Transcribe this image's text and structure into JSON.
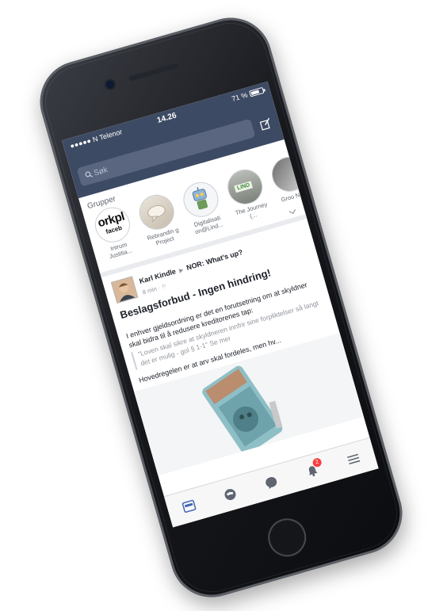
{
  "status": {
    "carrier": "●●●●● N Telenor",
    "time": "14.26",
    "battery": "71 %",
    "battery_level": 0.71
  },
  "search": {
    "placeholder": "Søk"
  },
  "groups": {
    "title": "Grupper",
    "items": [
      {
        "name": "Intrum Justitia...",
        "logo_text": "orkpl",
        "logo_sub": "faceb",
        "icon": "workplace-logo"
      },
      {
        "name": "Rebrandin g Project",
        "icon": "rebranding-photo"
      },
      {
        "name": "Digitalisati on@Lind...",
        "icon": "robot-photo"
      },
      {
        "name": "The Journey (...",
        "logo_text": "LIND",
        "icon": "lindorff-photo"
      },
      {
        "name": "Grou News",
        "icon": "group-news-photo"
      }
    ]
  },
  "post": {
    "author": "Karl Kindle",
    "arrow": "▶",
    "group": "NOR: What's up?",
    "meta": "8 min · ⚐",
    "title": "Beslagsforbud - Ingen hindring!",
    "para1": "I enhver gjeldsordning er det en forutsetning om at skyldner skal bidra til å redusere kreditorenes tap:",
    "quote": "\"Loven skal sikre at skyldneren innfrir sine forpliktelser så langt det er mulig - gol § 1-1\"",
    "see_more": "Se mer",
    "para2": "Hovedregelen er at arv skal fordeles, men hv..."
  },
  "tabbar": {
    "items": [
      "news-feed-icon",
      "groups-icon",
      "messenger-icon",
      "notifications-icon",
      "menu-icon"
    ],
    "notification_count": "2"
  },
  "colors": {
    "header_bg": "#3d4a63",
    "accent": "#4267b2",
    "badge": "#fa3e3e"
  }
}
